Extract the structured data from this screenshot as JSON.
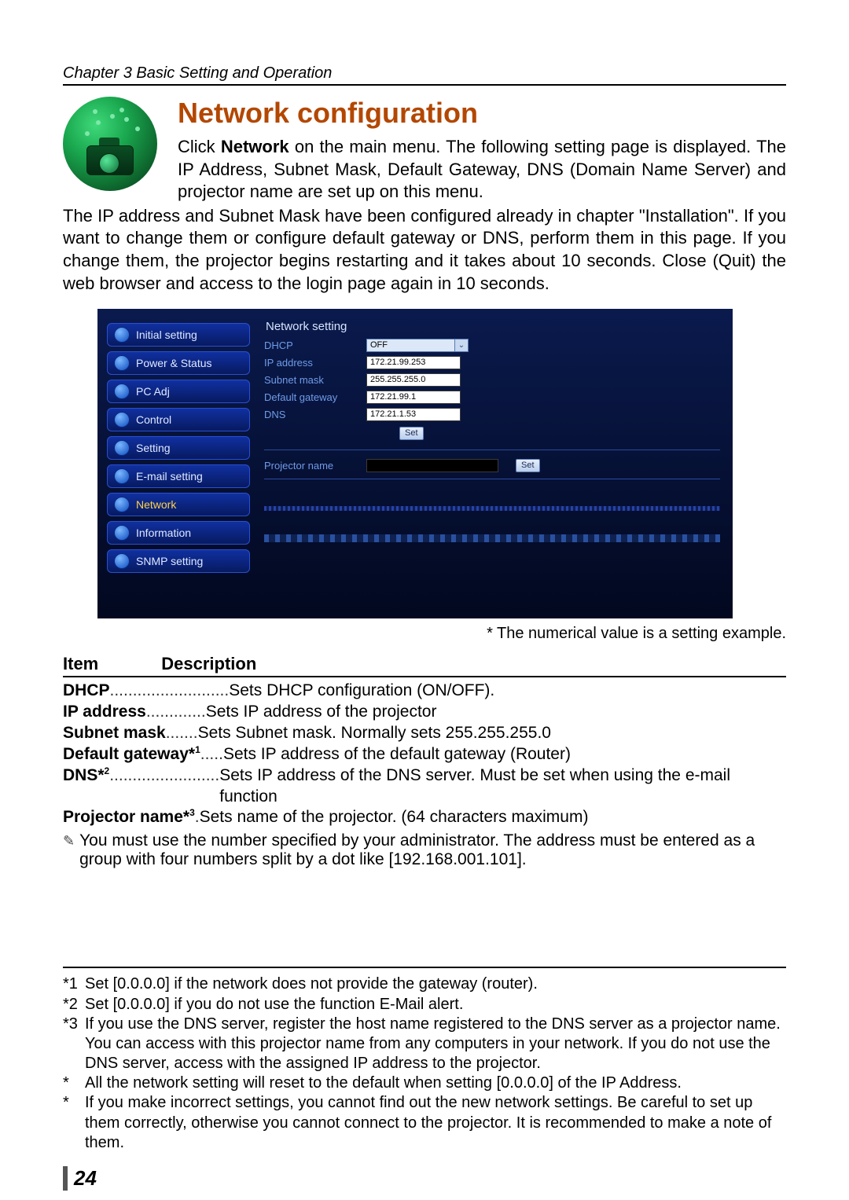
{
  "chapter": "Chapter 3 Basic Setting and Operation",
  "section_title": "Network configuration",
  "intro1": "Click Network on the main menu. The following setting page is displayed. The IP Address, Subnet Mask, Default Gateway, DNS (Domain Name Server) and projector name are set up on this menu.",
  "intro2": "The IP address and Subnet Mask have been configured already in chapter \"Installation\". If you want to change them or configure default gateway or DNS, perform them in this page. If you change them, the projector begins restarting and it takes about 10 seconds. Close (Quit) the web browser and access to the login page again in 10 seconds.",
  "screenshot": {
    "menu": [
      "Initial setting",
      "Power & Status",
      "PC Adj",
      "Control",
      "Setting",
      "E-mail setting",
      "Network",
      "Information",
      "SNMP setting"
    ],
    "selected_menu": "Network",
    "panel_heading": "Network setting",
    "fields": {
      "dhcp_label": "DHCP",
      "dhcp_value": "OFF",
      "ip_label": "IP address",
      "ip_value": "172.21.99.253",
      "subnet_label": "Subnet mask",
      "subnet_value": "255.255.255.0",
      "gateway_label": "Default gateway",
      "gateway_value": "172.21.99.1",
      "dns_label": "DNS",
      "dns_value": "172.21.1.53",
      "set_btn": "Set",
      "projector_label": "Projector name",
      "projector_value": "",
      "set_btn2": "Set"
    }
  },
  "fig_note": "* The numerical value is a setting example.",
  "table_header": {
    "item": "Item",
    "desc": "Description"
  },
  "items": [
    {
      "key": "DHCP",
      "dots": "..........................",
      "desc": "Sets DHCP configuration (ON/OFF)."
    },
    {
      "key": "IP address",
      "dots": ".............",
      "desc": "Sets IP address of the projector"
    },
    {
      "key": "Subnet mask",
      "dots": ".......",
      "desc": "Sets Subnet mask. Normally sets 255.255.255.0"
    },
    {
      "key": "Default gateway*1",
      "sup": "1",
      "keybase": "Default gateway*",
      "dots": " .....",
      "desc": "Sets IP address of the default gateway (Router)"
    },
    {
      "key": "DNS*2",
      "sup": "2",
      "keybase": "DNS*",
      "dots": " ........................",
      "desc": "Sets IP address of the DNS server. Must be set when using the e-mail function"
    },
    {
      "key": "Projector name*3",
      "sup": "3",
      "keybase": "Projector name*",
      "dots": ".",
      "desc": "Sets name of the projector. (64 characters maximum)"
    }
  ],
  "note": "You must use the number specified by your administrator. The address must be entered as a group with four numbers split by a dot like [192.168.001.101].",
  "footnotes": [
    {
      "mark": "*1",
      "text": "Set [0.0.0.0] if the network does not provide the gateway (router)."
    },
    {
      "mark": "*2",
      "text": "Set [0.0.0.0] if you do not use the function E-Mail alert."
    },
    {
      "mark": "*3",
      "text": "If you use the DNS server, register the host name registered to the DNS server as a projector name. You can access with this projector name from any computers in your network. If you do not use the DNS server, access with the assigned IP address to the projector."
    },
    {
      "mark": "*",
      "text": "All the network setting will reset to the default when setting [0.0.0.0] of the IP Address."
    },
    {
      "mark": "*",
      "text": "If you make incorrect settings, you cannot find out the new network settings. Be careful to set up them correctly, otherwise you cannot connect to the projector. It is recommended to make a note of them."
    }
  ],
  "page_number": "24"
}
